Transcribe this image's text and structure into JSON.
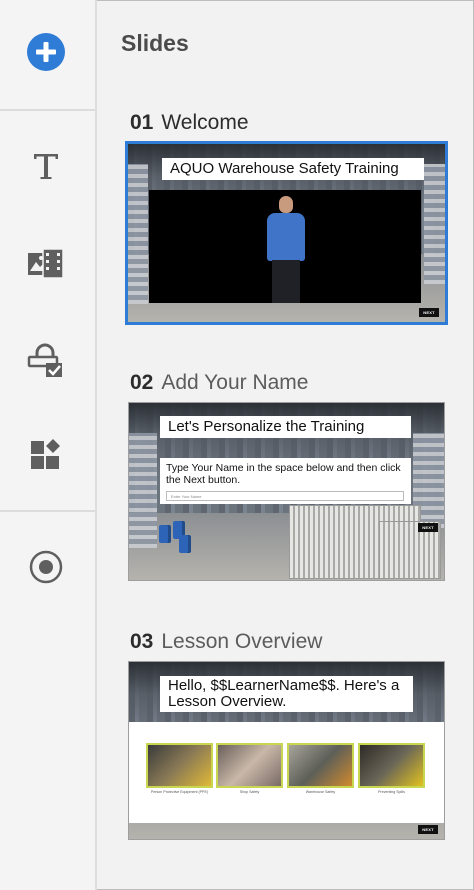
{
  "panel": {
    "title": "Slides"
  },
  "rail": {
    "tools": [
      {
        "icon": "add-icon"
      },
      {
        "icon": "text-icon"
      },
      {
        "icon": "media-icon"
      },
      {
        "icon": "interaction-icon"
      },
      {
        "icon": "widgets-icon"
      },
      {
        "icon": "record-icon"
      }
    ],
    "accent_color": "#2f7cd6"
  },
  "slides": [
    {
      "number": "01",
      "name": "Welcome",
      "selected": true,
      "thumbnail": {
        "banner": "AQUO Warehouse Safety Training",
        "next_button": "NEXT"
      }
    },
    {
      "number": "02",
      "name": "Add Your Name",
      "selected": false,
      "thumbnail": {
        "banner": "Let's Personalize the Training",
        "instruction": "Type Your Name in the space below and then click the Next button.",
        "input_placeholder": "Enter Your Name",
        "next_button": "NEXT"
      }
    },
    {
      "number": "03",
      "name": "Lesson Overview",
      "selected": false,
      "thumbnail": {
        "banner_line1": "Hello, $$LearnerName$$. Here's a",
        "banner_line2": "Lesson Overview.",
        "lessons": [
          "Person Protective Equipment (PPE)",
          "Shop Safety",
          "Warehouse Safety",
          "Preventing Spills"
        ],
        "next_button": "NEXT"
      }
    }
  ]
}
